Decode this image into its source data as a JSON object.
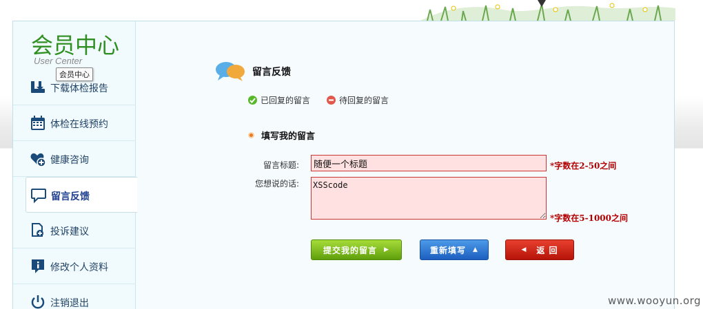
{
  "sidebar": {
    "logo_title": "会员中心",
    "logo_subtitle": "User Center",
    "tooltip": "会员中心",
    "items": [
      {
        "label": "下载体检报告",
        "icon": "download-icon"
      },
      {
        "label": "体检在线预约",
        "icon": "calendar-icon"
      },
      {
        "label": "健康咨询",
        "icon": "heart-plus-icon"
      },
      {
        "label": "留言反馈",
        "icon": "chat-bubble-icon",
        "active": true
      },
      {
        "label": "投诉建议",
        "icon": "document-plus-icon"
      },
      {
        "label": "修改个人资料",
        "icon": "info-icon"
      },
      {
        "label": "注销退出",
        "icon": "power-icon"
      }
    ]
  },
  "content": {
    "title": "留言反馈",
    "legend": {
      "replied": "已回复的留言",
      "pending": "待回复的留言"
    },
    "section": "填写我的留言",
    "form": {
      "title_label": "留言标题:",
      "title_value": "随便一个标题",
      "title_hint": "*字数在2-50之间",
      "message_label": "您想说的话:",
      "message_value": "XSScode",
      "message_hint": "*字数在5-1000之间"
    },
    "buttons": {
      "submit": "提交我的留言",
      "reset": "重新填写",
      "back": "返 回"
    }
  },
  "watermark": "www.wooyun.org",
  "colors": {
    "accent_green": "#2f8f21",
    "hint_red": "#b30000",
    "submit_green": "#6aae12",
    "reset_blue": "#2a6fd0",
    "back_red": "#c4190c"
  }
}
